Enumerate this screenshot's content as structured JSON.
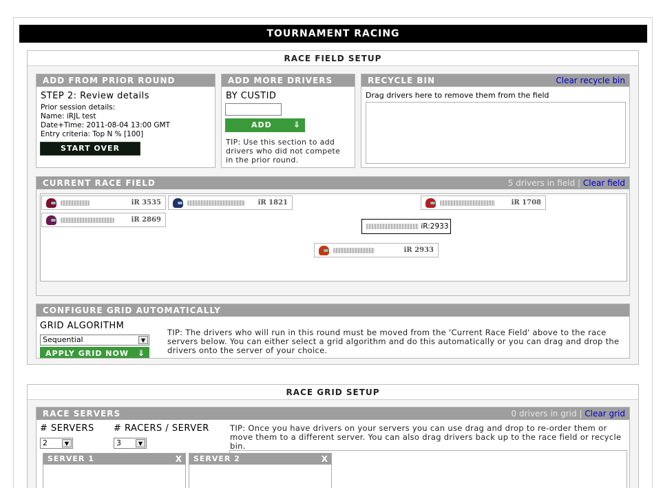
{
  "header": {
    "title": "TOURNAMENT RACING"
  },
  "field_setup": {
    "title": "RACE FIELD SETUP",
    "prior_round": {
      "title": "ADD FROM PRIOR ROUND",
      "step": "STEP 2: Review details",
      "details_label": "Prior session details:",
      "name_line": "Name: iRJL test",
      "datetime_line": "Date+Time: 2011-08-04 13:00 GMT",
      "criteria_line": "Entry criteria: Top N % [100]",
      "start_over": "START OVER"
    },
    "more_drivers": {
      "title": "ADD MORE DRIVERS",
      "by_label": "BY CUSTID",
      "custid_value": "",
      "add_button": "ADD",
      "tip": "TIP: Use this section to add drivers who did not compete in the prior round."
    },
    "recycle": {
      "title": "RECYCLE BIN",
      "clear_link": "Clear recycle bin",
      "hint": "Drag drivers here to remove them from the field"
    },
    "current_field": {
      "title": "CURRENT RACE FIELD",
      "count_text": "5 drivers in field",
      "separator": "|",
      "clear_link": "Clear field",
      "drivers": [
        {
          "ir": "iR 3535",
          "helmet": "#7a1030"
        },
        {
          "ir": "iR 1821",
          "helmet": "#20306a"
        },
        {
          "ir": "iR 1708",
          "helmet": "#b02020"
        },
        {
          "ir": "iR 2869",
          "helmet": "#6a1a50"
        },
        {
          "ir": "iR 2933",
          "helmet": "#c03a10"
        }
      ],
      "drag_tooltip": "iR:2933"
    },
    "configure": {
      "title": "CONFIGURE GRID AUTOMATICALLY",
      "algorithm_label": "GRID ALGORITHM",
      "algorithm_value": "Sequential",
      "apply_button": "APPLY GRID NOW",
      "tip": "TIP: The drivers who will run in this round must be moved from the 'Current Race Field' above to the race servers below. You can either select a grid algorithm and do this automatically or you can drag and drop the drivers onto the server of your choice."
    }
  },
  "grid_setup": {
    "title": "RACE GRID SETUP",
    "servers_box": {
      "title": "RACE SERVERS",
      "count_text": "0 drivers in grid",
      "separator": "|",
      "clear_link": "Clear grid",
      "servers_label": "# SERVERS",
      "servers_value": "2",
      "racers_label": "# RACERS / SERVER",
      "racers_value": "3",
      "tip": "TIP: Once you have drivers on your servers you can use drag and drop to re-order them or move them to a different server. You can also drag drivers back up to the race field or recycle bin.",
      "servers": [
        {
          "name": "SERVER 1",
          "close": "X"
        },
        {
          "name": "SERVER 2",
          "close": "X"
        }
      ]
    }
  }
}
